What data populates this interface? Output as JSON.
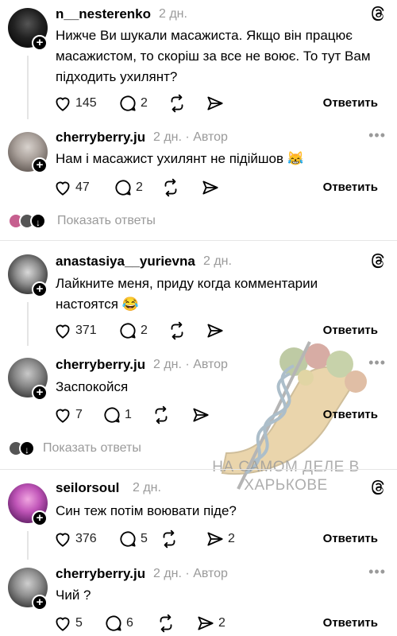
{
  "posts": [
    {
      "username": "n__nesterenko",
      "time": "2 дн.",
      "text": "Нижче Ви шукали масажиста. Якщо він працює масажистом, то скоріш за все не воює. То тут Вам підходить ухилянт?",
      "likes": "145",
      "replies": "2",
      "reposts": "",
      "shares": "",
      "reply_label": "Ответить"
    },
    {
      "username": "cherryberry.ju",
      "time": "2 дн.",
      "author": "Автор",
      "text": "Нам і масажист ухилянт не підійшов 😹",
      "likes": "47",
      "replies": "2",
      "reposts": "",
      "shares": "",
      "reply_label": "Ответить"
    },
    {
      "username": "anastasiya__yurievna",
      "time": "2 дн.",
      "text": "Лайкните меня, приду когда комментарии настоятся 😂",
      "likes": "371",
      "replies": "2",
      "reposts": "",
      "shares": "",
      "reply_label": "Ответить"
    },
    {
      "username": "cherryberry.ju",
      "time": "2 дн.",
      "author": "Автор",
      "text": "Заспокойся",
      "likes": "7",
      "replies": "1",
      "reposts": "",
      "shares": "",
      "reply_label": "Ответить"
    },
    {
      "username": "seilorsoul",
      "time": "2 дн.",
      "text": "Син теж потім воювати піде?",
      "likes": "376",
      "replies": "5",
      "reposts": "",
      "shares": "2",
      "reply_label": "Ответить"
    },
    {
      "username": "cherryberry.ju",
      "time": "2 дн.",
      "author": "Автор",
      "text": "Чий ?",
      "likes": "5",
      "replies": "6",
      "reposts": "",
      "shares": "2",
      "reply_label": "Ответить"
    }
  ],
  "show_replies": [
    "Показать ответы",
    "Показать ответы"
  ],
  "watermark": {
    "line1": "НА САМОМ ДЕЛЕ В",
    "line2": "ХАРЬКОВЕ"
  },
  "more_icon": "more-horizontal-icon",
  "threads_icon": "threads-logo-icon",
  "colors": {
    "meta": "#9a9a9a",
    "text": "#000000",
    "divider": "#e6e6e6"
  }
}
